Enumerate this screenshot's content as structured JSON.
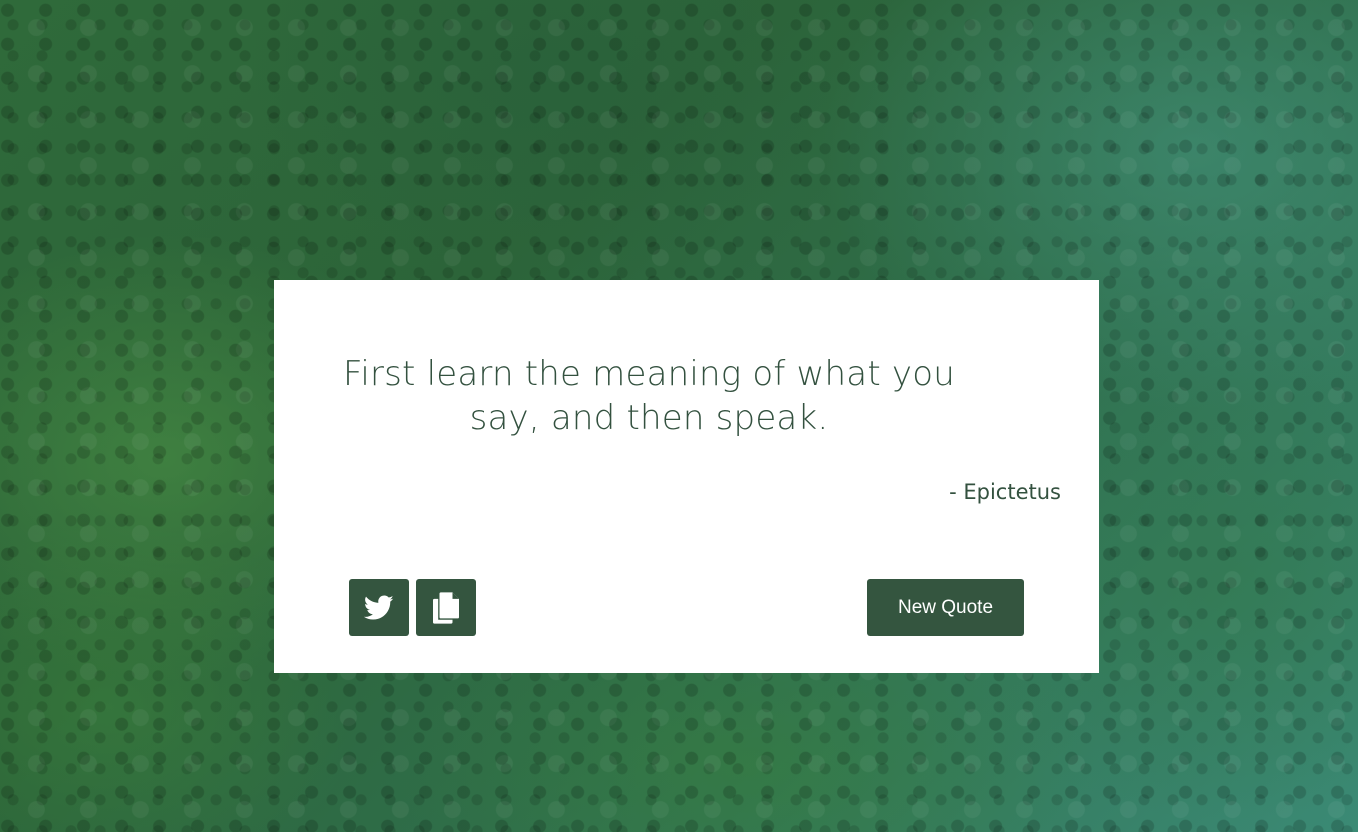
{
  "background": {
    "image": "forest-canopy-photo",
    "accent_color": "#34553f"
  },
  "quote": {
    "text": "First learn the meaning of what you say, and then speak.",
    "author": "- Epictetus"
  },
  "actions": {
    "twitter_icon": "twitter-icon",
    "copy_icon": "copy-icon",
    "new_quote_label": "New Quote"
  }
}
